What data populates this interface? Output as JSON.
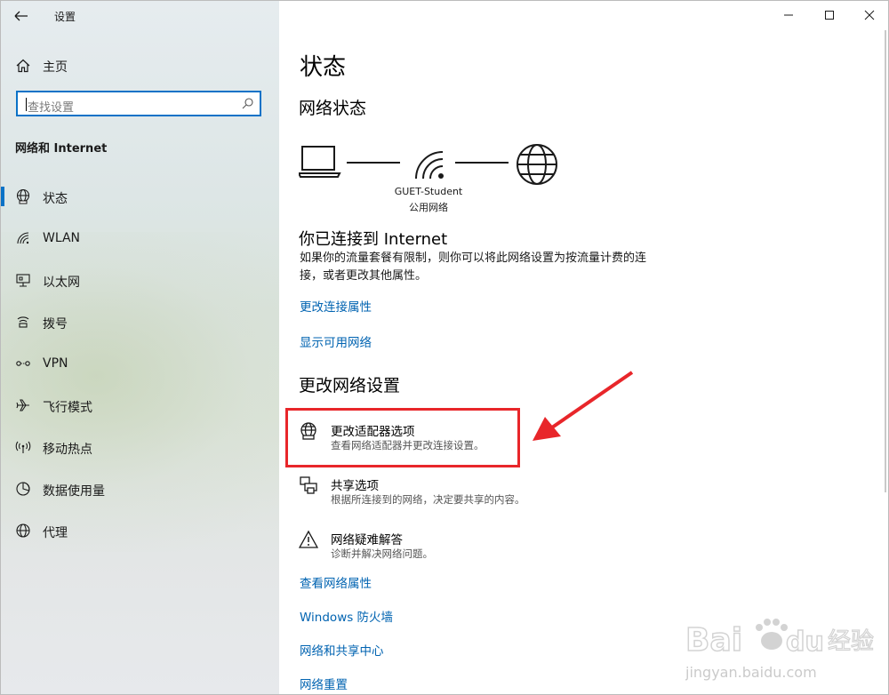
{
  "window": {
    "title": "设置",
    "controls": {
      "minimize": "minimize-icon",
      "maximize": "maximize-icon",
      "close": "close-icon"
    }
  },
  "sidebar": {
    "home_label": "主页",
    "search_placeholder": "查找设置",
    "section_title": "网络和 Internet",
    "items": [
      {
        "label": "状态",
        "icon": "globe-status-icon",
        "active": true
      },
      {
        "label": "WLAN",
        "icon": "wifi-icon",
        "active": false
      },
      {
        "label": "以太网",
        "icon": "ethernet-icon",
        "active": false
      },
      {
        "label": "拨号",
        "icon": "dialup-icon",
        "active": false
      },
      {
        "label": "VPN",
        "icon": "vpn-icon",
        "active": false
      },
      {
        "label": "飞行模式",
        "icon": "airplane-icon",
        "active": false
      },
      {
        "label": "移动热点",
        "icon": "hotspot-icon",
        "active": false
      },
      {
        "label": "数据使用量",
        "icon": "data-usage-icon",
        "active": false
      },
      {
        "label": "代理",
        "icon": "proxy-globe-icon",
        "active": false
      }
    ]
  },
  "main": {
    "page_title": "状态",
    "network_status_heading": "网络状态",
    "network_name": "GUET-Student",
    "network_type": "公用网络",
    "connected_heading": "你已连接到 Internet",
    "connected_text": "如果你的流量套餐有限制，则你可以将此网络设置为按流量计费的连接，或者更改其他属性。",
    "links_top": [
      "更改连接属性",
      "显示可用网络"
    ],
    "change_heading": "更改网络设置",
    "options": [
      {
        "title": "更改适配器选项",
        "desc": "查看网络适配器并更改连接设置。",
        "icon": "adapter-globe-icon"
      },
      {
        "title": "共享选项",
        "desc": "根据所连接到的网络，决定要共享的内容。",
        "icon": "sharing-printer-icon"
      },
      {
        "title": "网络疑难解答",
        "desc": "诊断并解决网络问题。",
        "icon": "warning-triangle-icon"
      }
    ],
    "links_bottom": [
      "查看网络属性",
      "Windows 防火墙",
      "网络和共享中心",
      "网络重置"
    ]
  },
  "annotation": {
    "highlight_color": "#e8262a"
  },
  "watermark": {
    "brand": "Baidu",
    "brand_cn": "经验",
    "url": "jingyan.baidu.com"
  },
  "colors": {
    "accent": "#0a72c7",
    "link": "#0063b1"
  }
}
